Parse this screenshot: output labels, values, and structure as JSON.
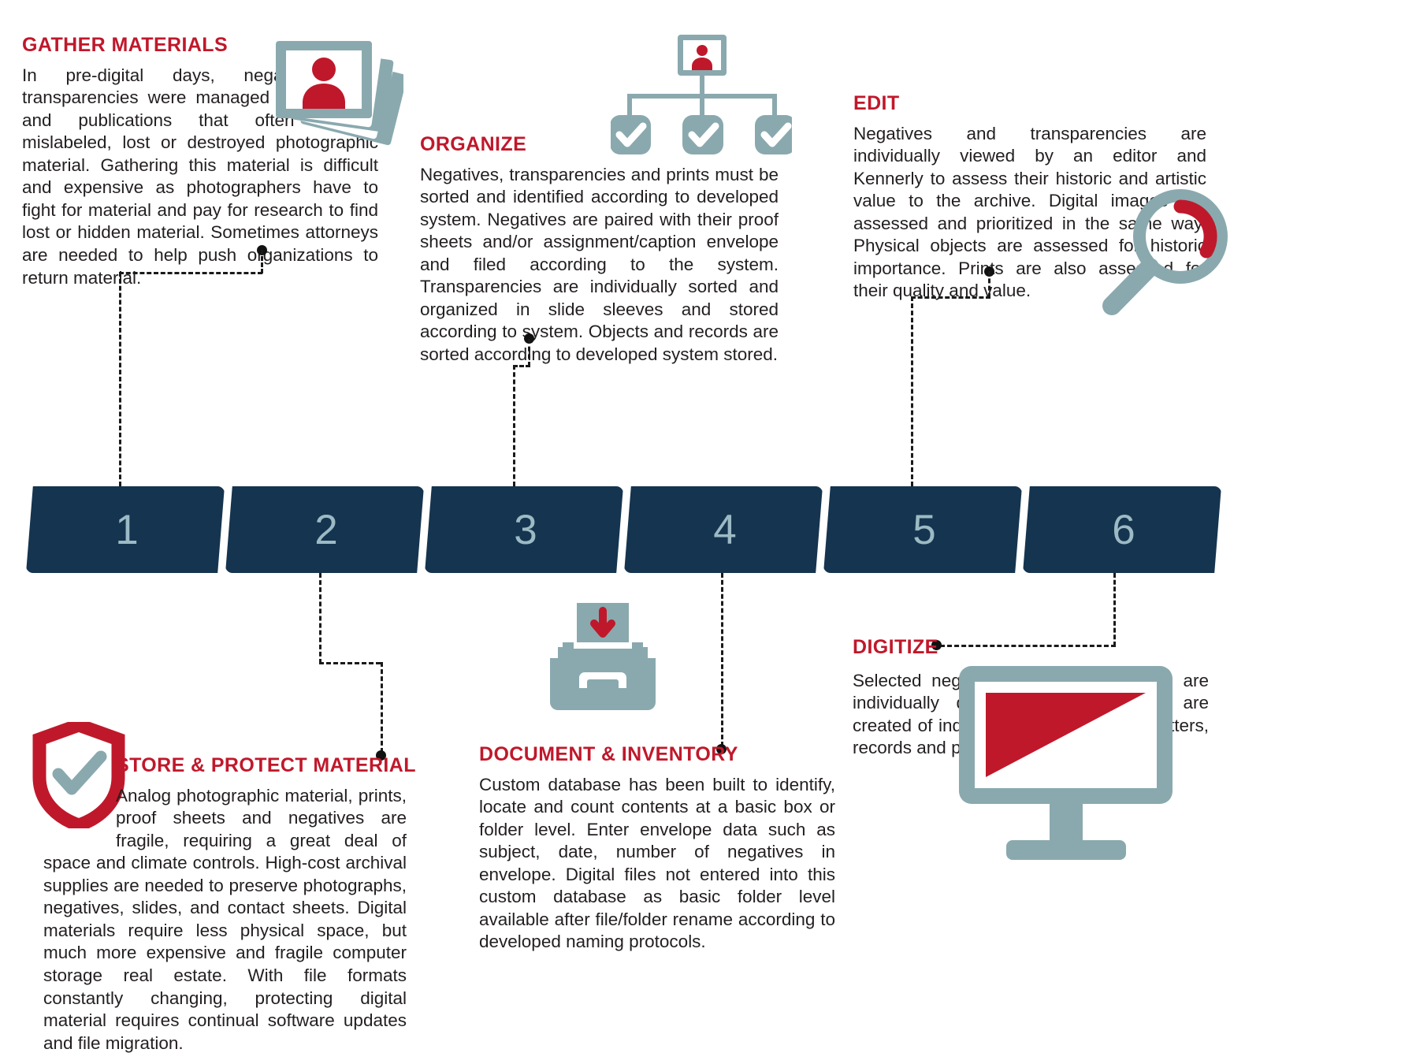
{
  "colors": {
    "red": "#c0182b",
    "navy": "#15344f",
    "teal": "#8aa9ae",
    "number": "#9cbac4",
    "text": "#231f20"
  },
  "steps": [
    {
      "number": "1"
    },
    {
      "number": "2"
    },
    {
      "number": "3"
    },
    {
      "number": "4"
    },
    {
      "number": "5"
    },
    {
      "number": "6"
    }
  ],
  "sections": {
    "gather": {
      "title": "GATHER MATERIALS",
      "body": "In pre-digital days, negatives and transparencies were managed by agencies and publications that often copied, mislabeled, lost or destroyed photographic material. Gathering this material is difficult and expensive as photographers have to fight for material and pay for research to find lost or hidden material. Sometimes attorneys are needed to help push organizations to return material."
    },
    "organize": {
      "title": "ORGANIZE",
      "body": "Negatives, transparencies and prints must be sorted and identified according to developed system.  Negatives are paired with their proof sheets and/or assignment/caption envelope and filed according to the system. Transparencies are individually sorted and organized in slide sleeves and stored according to system. Objects and records are sorted according to developed system stored."
    },
    "edit": {
      "title": "EDIT",
      "body": "Negatives and transparencies are individually viewed by an editor and Kennerly to assess their historic and artistic value to the archive. Digital images are assessed and prioritized in the same way. Physical objects are assessed for historic importance. Prints are also assessed for their quality and value."
    },
    "store": {
      "title": "STORE & PROTECT MATERIAL",
      "body": "Analog photographic material, prints, proof sheets and negatives are fragile, requiring a great deal of space and climate controls.  High-cost archival supplies are needed to preserve photographs, negatives, slides, and contact sheets. Digital materials require less physical space, but much more expensive and fragile computer storage real estate. With file formats  constantly changing, protecting digital material requires continual software updates and file migration."
    },
    "document": {
      "title": "DOCUMENT & INVENTORY",
      "body": "Custom database has been built to identify, locate and count contents at a basic box or folder level. Enter envelope data such as subject, date, number of negatives in envelope.  Digital files not entered into this custom database as basic folder level available after file/folder rename according to developed naming protocols."
    },
    "digitize": {
      "title": "DIGITIZE",
      "body": "Selected negatives and transparencies are individually digitized. Digital images are created of individual  physical objects, letters, records and prints."
    }
  },
  "icons": {
    "photo_stack": "photo-stack-icon",
    "org_chart": "org-chart-icon",
    "magnifier": "magnifier-icon",
    "shield_check": "shield-check-icon",
    "file_box": "file-box-icon",
    "monitor": "monitor-icon"
  }
}
